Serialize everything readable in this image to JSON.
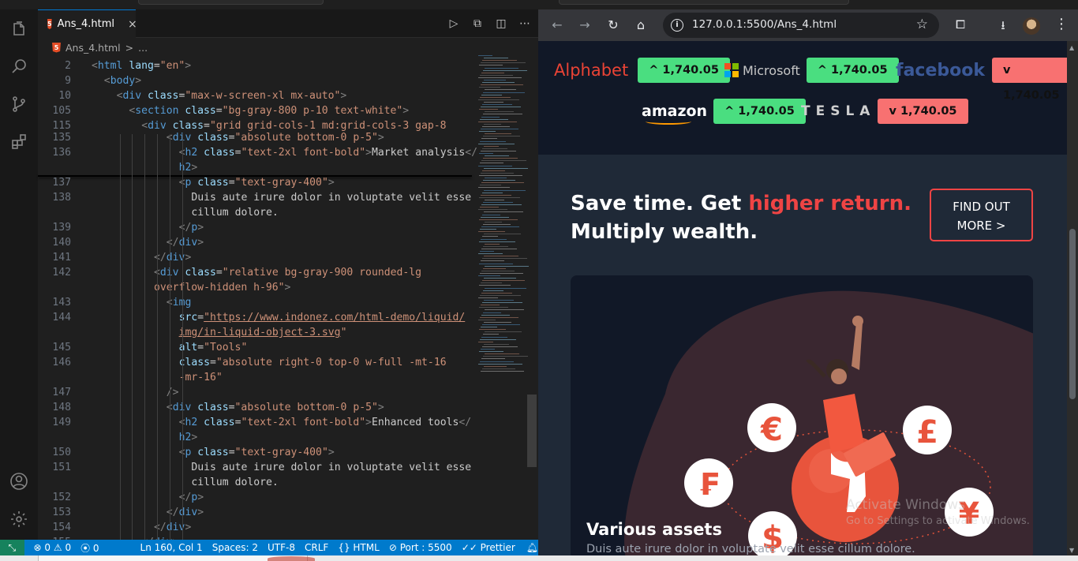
{
  "editor": {
    "tab_label": "Ans_4.html",
    "tab_close": "×",
    "file_badge": "5",
    "breadcrumb_file": "Ans_4.html",
    "breadcrumb_sep": ">",
    "breadcrumb_more": "...",
    "lines": [
      {
        "n": "2",
        "indent": 0,
        "parts": [
          [
            "t",
            "<"
          ],
          [
            "tn",
            "html"
          ],
          [
            "",
            ""
          ],
          [
            "an",
            " lang"
          ],
          [
            "",
            "="
          ],
          [
            "av",
            "\"en\""
          ],
          [
            "t",
            ">"
          ]
        ]
      },
      {
        "n": "9",
        "indent": 1,
        "parts": [
          [
            "t",
            "<"
          ],
          [
            "tn",
            "body"
          ],
          [
            "t",
            ">"
          ]
        ]
      },
      {
        "n": "10",
        "indent": 2,
        "parts": [
          [
            "t",
            "<"
          ],
          [
            "tn",
            "div"
          ],
          [
            "an",
            " class"
          ],
          [
            "",
            "="
          ],
          [
            "av",
            "\"max-w-screen-xl mx-auto\""
          ],
          [
            "t",
            ">"
          ]
        ]
      },
      {
        "n": "105",
        "indent": 3,
        "parts": [
          [
            "t",
            "<"
          ],
          [
            "tn",
            "section"
          ],
          [
            "an",
            " class"
          ],
          [
            "",
            "="
          ],
          [
            "av",
            "\"bg-gray-800 p-10 text-white\""
          ],
          [
            "t",
            ">"
          ]
        ]
      },
      {
        "n": "115",
        "indent": 4,
        "parts": [
          [
            "t",
            "<"
          ],
          [
            "tn",
            "div"
          ],
          [
            "an",
            " class"
          ],
          [
            "",
            "="
          ],
          [
            "av",
            "\"grid grid-cols-1 md:grid-cols-3 gap-8"
          ]
        ]
      },
      {
        "n": "135",
        "indent": 6,
        "parts": [
          [
            "t",
            "<"
          ],
          [
            "tn",
            "div"
          ],
          [
            "an",
            " class"
          ],
          [
            "",
            "="
          ],
          [
            "av",
            "\"absolute bottom-0 p-5\""
          ],
          [
            "t",
            ">"
          ]
        ]
      },
      {
        "n": "136",
        "indent": 7,
        "parts": [
          [
            "t",
            "<"
          ],
          [
            "tn",
            "h2"
          ],
          [
            "an",
            " class"
          ],
          [
            "",
            "="
          ],
          [
            "av",
            "\"text-2xl font-bold\""
          ],
          [
            "t",
            ">"
          ],
          [
            "",
            "Market analysis"
          ],
          [
            "t",
            "</"
          ]
        ]
      },
      {
        "n": "",
        "indent": 7,
        "parts": [
          [
            "tn",
            "h2"
          ],
          [
            "t",
            ">"
          ]
        ]
      },
      {
        "n": "137",
        "indent": 7,
        "parts": [
          [
            "t",
            "<"
          ],
          [
            "tn",
            "p"
          ],
          [
            "an",
            " class"
          ],
          [
            "",
            "="
          ],
          [
            "av",
            "\"text-gray-400\""
          ],
          [
            "t",
            ">"
          ]
        ]
      },
      {
        "n": "138",
        "indent": 8,
        "parts": [
          [
            "",
            "Duis aute irure dolor in voluptate velit esse"
          ]
        ]
      },
      {
        "n": "",
        "indent": 8,
        "parts": [
          [
            "",
            "cillum dolore."
          ]
        ]
      },
      {
        "n": "139",
        "indent": 7,
        "parts": [
          [
            "t",
            "</"
          ],
          [
            "tn",
            "p"
          ],
          [
            "t",
            ">"
          ]
        ]
      },
      {
        "n": "140",
        "indent": 6,
        "parts": [
          [
            "t",
            "</"
          ],
          [
            "tn",
            "div"
          ],
          [
            "t",
            ">"
          ]
        ]
      },
      {
        "n": "141",
        "indent": 5,
        "parts": [
          [
            "t",
            "</"
          ],
          [
            "tn",
            "div"
          ],
          [
            "t",
            ">"
          ]
        ]
      },
      {
        "n": "142",
        "indent": 5,
        "parts": [
          [
            "t",
            "<"
          ],
          [
            "tn",
            "div"
          ],
          [
            "an",
            " class"
          ],
          [
            "",
            "="
          ],
          [
            "av",
            "\"relative bg-gray-900 rounded-lg"
          ]
        ]
      },
      {
        "n": "",
        "indent": 5,
        "parts": [
          [
            "av",
            "overflow-hidden h-96\""
          ],
          [
            "t",
            ">"
          ]
        ]
      },
      {
        "n": "143",
        "indent": 6,
        "parts": [
          [
            "t",
            "<"
          ],
          [
            "tn",
            "img"
          ]
        ]
      },
      {
        "n": "144",
        "indent": 7,
        "parts": [
          [
            "an",
            "src"
          ],
          [
            "",
            "="
          ],
          [
            "avu",
            "\"https://www.indonez.com/html-demo/liquid/"
          ]
        ]
      },
      {
        "n": "",
        "indent": 7,
        "parts": [
          [
            "avu",
            "img/in-liquid-object-3.svg"
          ],
          [
            "av",
            "\""
          ]
        ]
      },
      {
        "n": "145",
        "indent": 7,
        "parts": [
          [
            "an",
            "alt"
          ],
          [
            "",
            "="
          ],
          [
            "av",
            "\"Tools\""
          ]
        ]
      },
      {
        "n": "146",
        "indent": 7,
        "parts": [
          [
            "an",
            "class"
          ],
          [
            "",
            "="
          ],
          [
            "av",
            "\"absolute right-0 top-0 w-full -mt-16"
          ]
        ]
      },
      {
        "n": "",
        "indent": 7,
        "parts": [
          [
            "av",
            "-mr-16\""
          ]
        ]
      },
      {
        "n": "147",
        "indent": 6,
        "parts": [
          [
            "t",
            "/>"
          ]
        ]
      },
      {
        "n": "148",
        "indent": 6,
        "parts": [
          [
            "t",
            "<"
          ],
          [
            "tn",
            "div"
          ],
          [
            "an",
            " class"
          ],
          [
            "",
            "="
          ],
          [
            "av",
            "\"absolute bottom-0 p-5\""
          ],
          [
            "t",
            ">"
          ]
        ]
      },
      {
        "n": "149",
        "indent": 7,
        "parts": [
          [
            "t",
            "<"
          ],
          [
            "tn",
            "h2"
          ],
          [
            "an",
            " class"
          ],
          [
            "",
            "="
          ],
          [
            "av",
            "\"text-2xl font-bold\""
          ],
          [
            "t",
            ">"
          ],
          [
            "",
            "Enhanced tools"
          ],
          [
            "t",
            "</"
          ]
        ]
      },
      {
        "n": "",
        "indent": 7,
        "parts": [
          [
            "tn",
            "h2"
          ],
          [
            "t",
            ">"
          ]
        ]
      },
      {
        "n": "150",
        "indent": 7,
        "parts": [
          [
            "t",
            "<"
          ],
          [
            "tn",
            "p"
          ],
          [
            "an",
            " class"
          ],
          [
            "",
            "="
          ],
          [
            "av",
            "\"text-gray-400\""
          ],
          [
            "t",
            ">"
          ]
        ]
      },
      {
        "n": "151",
        "indent": 8,
        "parts": [
          [
            "",
            "Duis aute irure dolor in voluptate velit esse"
          ]
        ]
      },
      {
        "n": "",
        "indent": 8,
        "parts": [
          [
            "",
            "cillum dolore."
          ]
        ]
      },
      {
        "n": "152",
        "indent": 7,
        "parts": [
          [
            "t",
            "</"
          ],
          [
            "tn",
            "p"
          ],
          [
            "t",
            ">"
          ]
        ]
      },
      {
        "n": "153",
        "indent": 6,
        "parts": [
          [
            "t",
            "</"
          ],
          [
            "tn",
            "div"
          ],
          [
            "t",
            ">"
          ]
        ]
      },
      {
        "n": "154",
        "indent": 5,
        "parts": [
          [
            "t",
            "</"
          ],
          [
            "tn",
            "div"
          ],
          [
            "t",
            ">"
          ]
        ]
      },
      {
        "n": "155",
        "indent": 4,
        "parts": [
          [
            "t",
            "</"
          ],
          [
            "tn",
            "div"
          ],
          [
            "t",
            ">"
          ]
        ]
      }
    ]
  },
  "statusbar": {
    "errors": "0",
    "warnings": "0",
    "ports": "0",
    "position": "Ln 160, Col 1",
    "spaces": "Spaces: 2",
    "encoding": "UTF-8",
    "eol": "CRLF",
    "language": "HTML",
    "port": "Port : 5500",
    "formatter": "Prettier"
  },
  "browser": {
    "url": "127.0.0.1:5500/Ans_4.html",
    "tickers": [
      {
        "brand": "Alphabet",
        "value": "^ 1,740.05",
        "dir": "up"
      },
      {
        "brand": "Microsoft",
        "value": "^ 1,740.05",
        "dir": "up"
      },
      {
        "brand": "facebook",
        "value": "v 1,740.05",
        "dir": "down"
      },
      {
        "brand": "amazon",
        "value": "^ 1,740.05",
        "dir": "up"
      },
      {
        "brand": "TESLA",
        "value": "v 1,740.05",
        "dir": "down"
      }
    ],
    "hero_part1": "Save time. Get ",
    "hero_highlight": "higher return.",
    "hero_line2": "Multiply wealth.",
    "cta_line1": "FIND OUT",
    "cta_line2": "MORE >",
    "card_title": "Various assets",
    "card_subtitle": "Duis aute irure dolor in voluptate velit esse cillum dolore.",
    "currency_symbols": [
      "€",
      "£",
      "₣",
      "¥",
      "$"
    ],
    "watermark_title": "Activate Windows",
    "watermark_sub": "Go to Settings to activate Windows."
  },
  "colors": {
    "up": "#4ade80",
    "down": "#f87171",
    "accent_red": "#ef4444",
    "statusbar": "#007acc"
  }
}
